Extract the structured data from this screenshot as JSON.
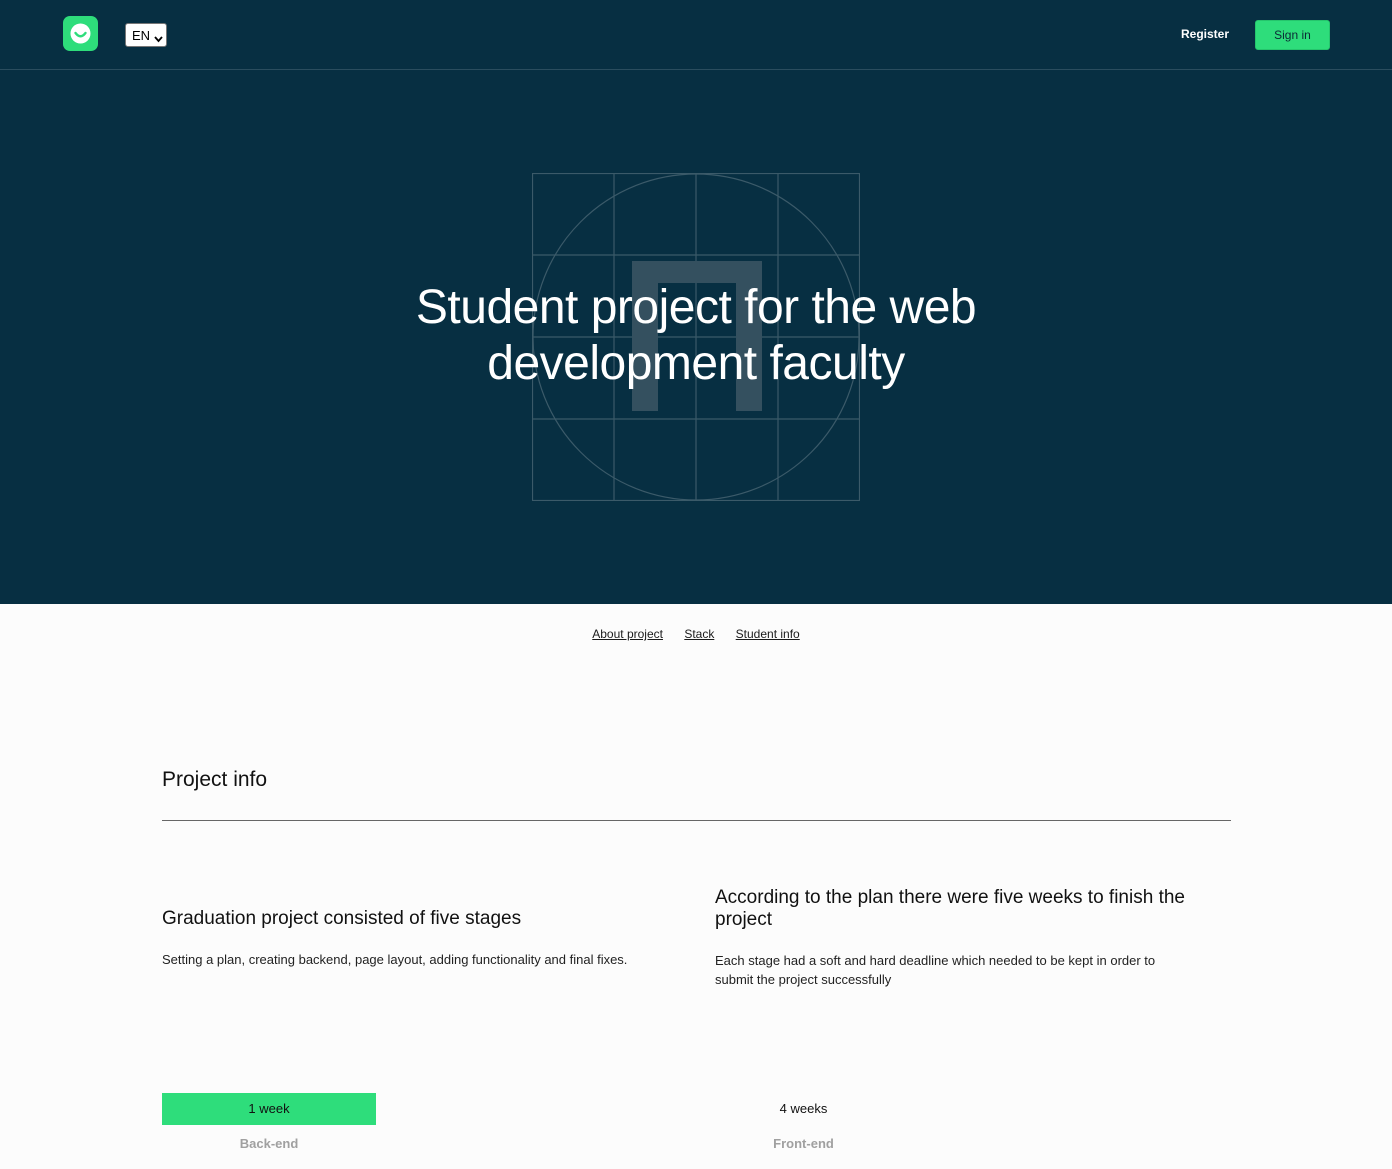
{
  "header": {
    "language": "EN",
    "register_label": "Register",
    "signin_label": "Sign in"
  },
  "hero": {
    "title_line1": "Student project for the web",
    "title_line2": "development faculty"
  },
  "nav": {
    "items": [
      "About project",
      "Stack",
      "Student info"
    ]
  },
  "project_info": {
    "title": "Project info",
    "cards": [
      {
        "heading": "Graduation project consisted of five stages",
        "text": "Setting a plan, creating backend, page layout, adding functionality and final fixes."
      },
      {
        "heading": "According to the plan there were five weeks to finish the project",
        "text": "Each stage had a soft and hard deadline which needed to be kept in order to submit the project successfully"
      }
    ],
    "timeline": [
      {
        "duration": "1 week",
        "label": "Back-end",
        "weeks": 1
      },
      {
        "duration": "4 weeks",
        "label": "Front-end",
        "weeks": 4
      }
    ]
  },
  "colors": {
    "dark_bg": "#072f42",
    "accent": "#2edd7b"
  }
}
